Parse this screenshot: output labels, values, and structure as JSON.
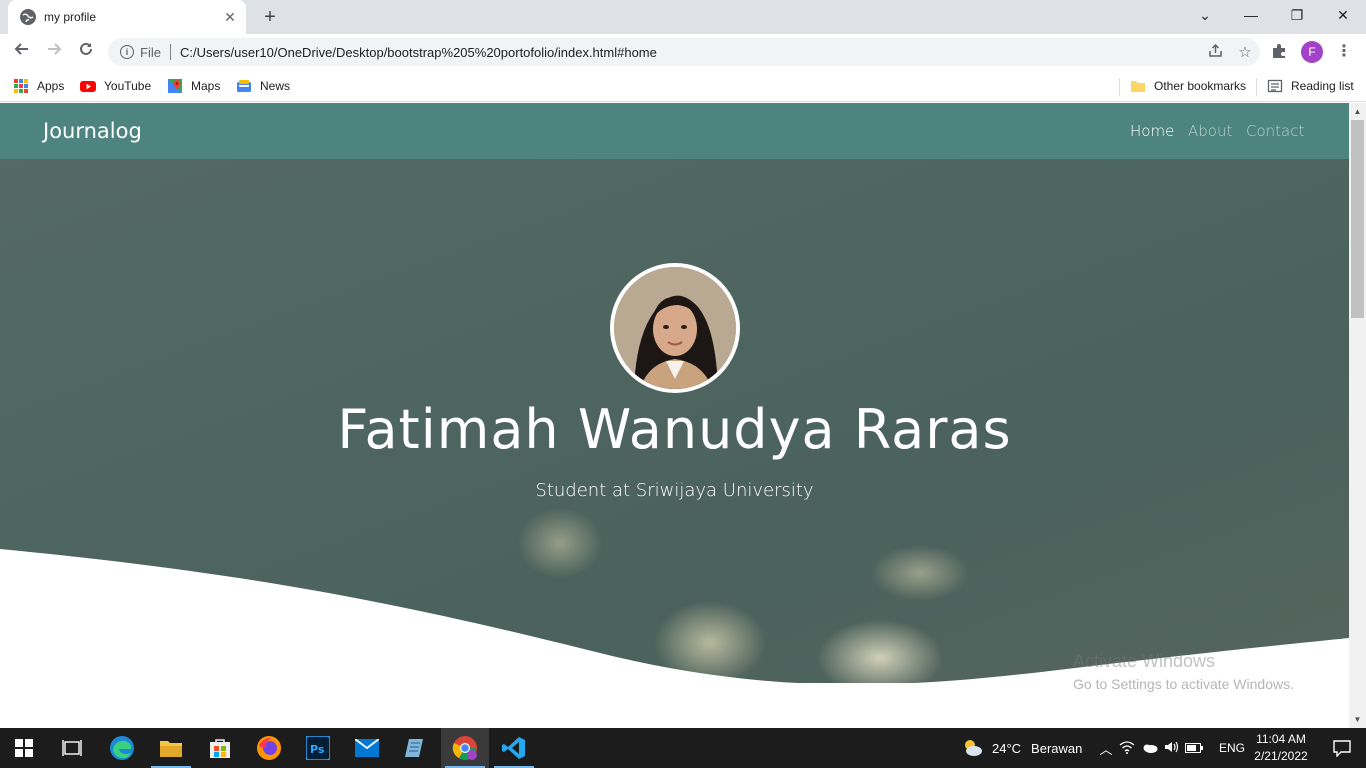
{
  "browser": {
    "tab_title": "my profile",
    "scheme_label": "File",
    "url": "C:/Users/user10/OneDrive/Desktop/bootstrap%205%20portofolio/index.html#home",
    "profile_initial": "F"
  },
  "bookmarks": {
    "items": [
      "Apps",
      "YouTube",
      "Maps",
      "News"
    ],
    "other": "Other bookmarks",
    "reading_list": "Reading list"
  },
  "site": {
    "brand": "Journalog",
    "nav": [
      "Home",
      "About",
      "Contact"
    ],
    "active_nav": "Home",
    "name": "Fatimah Wanudya Raras",
    "subtitle": "Student at Sriwijaya University"
  },
  "watermark": {
    "title": "Activate Windows",
    "subtitle": "Go to Settings to activate Windows."
  },
  "taskbar": {
    "weather_temp": "24°C",
    "weather_desc": "Berawan",
    "language": "ENG",
    "time": "11:04 AM",
    "date": "2/21/2022"
  },
  "colors": {
    "navbar": "#4d8480",
    "hero": "#4f6660",
    "profile_avatar": "#a142c9"
  }
}
